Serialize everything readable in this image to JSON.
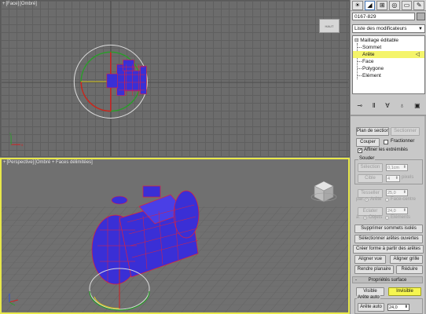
{
  "viewport_top": {
    "label_parts": [
      "+",
      "[Face]",
      "[Ombré]"
    ],
    "viewcube_label": "HAUT"
  },
  "viewport_persp": {
    "label_parts": [
      "+",
      "[Perspective]",
      "[Ombré + Faces délimitées]"
    ]
  },
  "panel": {
    "object_name": "0167-829",
    "modifier_list": "Liste des modificateurs",
    "stack": [
      {
        "label": "Maillage éditable",
        "level": 0
      },
      {
        "label": "Sommet",
        "level": 1
      },
      {
        "label": "Arête",
        "level": 1,
        "selected": true
      },
      {
        "label": "Face",
        "level": 1
      },
      {
        "label": "Polygone",
        "level": 1
      },
      {
        "label": "Elément",
        "level": 1
      }
    ],
    "tabs": [
      "create-icon",
      "modify-icon",
      "hierarchy-icon",
      "motion-icon",
      "display-icon",
      "utilities-icon"
    ],
    "stack_tools": [
      "pin-icon",
      "show-end-icon",
      "make-unique-icon",
      "remove-modifier-icon",
      "configure-icon"
    ]
  },
  "edit_geometry": {
    "plan_section": "Plan de section",
    "sectionner": "Sectionner",
    "couper": "Couper",
    "fractionner": "Fractionner",
    "affiner": "Affiner les extrémités",
    "souder_title": "Souder",
    "selection": "Sélection",
    "selection_val": "0,1cm",
    "cible": "Cible",
    "cible_val": "4",
    "pixels": "pixels",
    "tesseller": "Tesseller",
    "tesseller_val": "25,0",
    "par": "par:",
    "arete": "Arête",
    "face_centre": "Face-centre",
    "eclater": "Eclater",
    "eclater_val": "24,0",
    "a": "à:",
    "objets": "Objets",
    "elements": "Eléments",
    "supprimer": "Supprimer sommets isolés",
    "selectionner_aretes": "Sélectionner arêtes ouvertes",
    "creer_forme": "Créer forme à partir des arêtes",
    "aligner_vue": "Aligner vue",
    "aligner_grille": "Aligner grille",
    "rendre_planaire": "Rendre planaire",
    "reduire": "Réduire"
  },
  "surface_props": {
    "title": "Propriétés surface",
    "visible": "Visible",
    "invisible": "Invisible",
    "arete_auto_label": "Arête auto",
    "arete_auto_button": "Arête auto",
    "arete_auto_val": "24,0"
  },
  "colors": {
    "highlight": "#f6f650",
    "mesh": "#3a2fd6",
    "edges": "#e0203a"
  }
}
